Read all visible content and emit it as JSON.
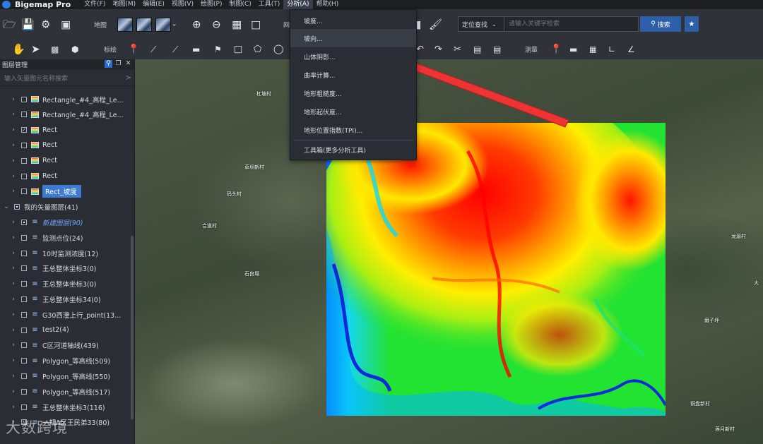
{
  "app": {
    "title": "Bigemap Pro"
  },
  "menu": {
    "items": [
      "文件(F)",
      "地图(M)",
      "编辑(E)",
      "视图(V)",
      "绘图(P)",
      "制图(C)",
      "工具(T)",
      "分析(A)",
      "帮助(H)"
    ],
    "active": "分析(A)"
  },
  "toolbar1": {
    "map_label": "地图",
    "partial_label": "网",
    "search": {
      "mode": "定位查找",
      "placeholder": "请输入关键字检索",
      "button": "搜索"
    }
  },
  "toolbar2": {
    "annotate_label": "标绘",
    "measure_label": "测量"
  },
  "layer_panel": {
    "title": "图层管理",
    "search_placeholder": "输入矢量图元名称搜索",
    "items": [
      {
        "label": "Rectangle_#4_高程_Le...",
        "type": "raster",
        "checked": false
      },
      {
        "label": "Rectangle_#4_高程_Le...",
        "type": "raster",
        "checked": false
      },
      {
        "label": "Rect",
        "type": "raster",
        "checked": true
      },
      {
        "label": "Rect",
        "type": "raster",
        "checked": false
      },
      {
        "label": "Rect",
        "type": "raster",
        "checked": false
      },
      {
        "label": "Rect",
        "type": "raster",
        "checked": false
      },
      {
        "label": "Rect_坡度",
        "type": "raster",
        "checked": false,
        "selected": true
      },
      {
        "label": "我的矢量图层(41)",
        "type": "group",
        "checked": false
      },
      {
        "label": "新建图层(90)",
        "type": "vector",
        "checked": true,
        "italic": true
      },
      {
        "label": "监测点位(24)",
        "type": "vector",
        "checked": false
      },
      {
        "label": "10时监测浓度(12)",
        "type": "vector",
        "checked": false
      },
      {
        "label": "王总整体坐标3(0)",
        "type": "vector",
        "checked": false
      },
      {
        "label": "王总整体坐标3(0)",
        "type": "vector",
        "checked": false
      },
      {
        "label": "王总整体坐标34(0)",
        "type": "vector",
        "checked": false
      },
      {
        "label": "G30西潼上行_point(13...",
        "type": "vector",
        "checked": false
      },
      {
        "label": "test2(4)",
        "type": "vector",
        "checked": false
      },
      {
        "label": "C区河道轴线(439)",
        "type": "vector",
        "checked": false
      },
      {
        "label": "Polygon_等高线(509)",
        "type": "vector",
        "checked": false
      },
      {
        "label": "Polygon_等高线(550)",
        "type": "vector",
        "checked": false
      },
      {
        "label": "Polygon_等高线(517)",
        "type": "vector",
        "checked": false
      },
      {
        "label": "王总整体坐标3(116)",
        "type": "vector",
        "checked": false
      },
      {
        "label": "一期A区王民弟33(80)",
        "type": "vector",
        "checked": false
      }
    ]
  },
  "analysis_menu": {
    "items": [
      "坡度...",
      "坡向...",
      "山体阴影...",
      "曲率计算...",
      "地形粗糙度...",
      "地形起伏度...",
      "地形位置指数(TPI)...",
      "工具箱(更多分析工具)"
    ],
    "hovered": "坡向..."
  },
  "map": {
    "places": [
      "杠坡村",
      "草坝新村",
      "码头村",
      "合道村",
      "石良塌",
      "龙源村",
      "大",
      "磨子坪",
      "铜盘新村",
      "莲月新村"
    ]
  },
  "watermark": "大数跨境",
  "colors": {
    "accent": "#2d5fa8",
    "arrow": "#ee3333",
    "selected_row": "#3d7bd0"
  }
}
